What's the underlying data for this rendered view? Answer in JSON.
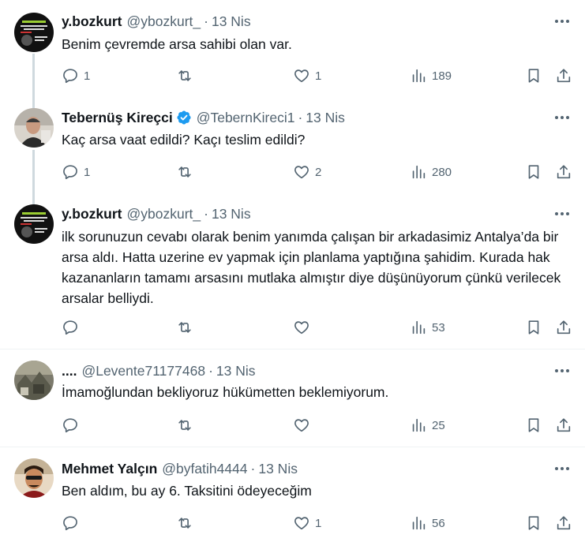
{
  "tweets": [
    {
      "name": "y.bozkurt",
      "handle": "@ybozkurt_",
      "dot": "·",
      "time": "13 Nis",
      "verified": false,
      "text": "Benim çevremde arsa sahibi olan var.",
      "replies": "1",
      "retweets": "",
      "likes": "1",
      "views": "189"
    },
    {
      "name": "Tebernüş Kireçci",
      "handle": "@TebernKireci1",
      "dot": "·",
      "time": "13 Nis",
      "verified": true,
      "text": "Kaç arsa vaat edildi? Kaçı teslim edildi?",
      "replies": "1",
      "retweets": "",
      "likes": "2",
      "views": "280"
    },
    {
      "name": "y.bozkurt",
      "handle": "@ybozkurt_",
      "dot": "·",
      "time": "13 Nis",
      "verified": false,
      "text": "ilk sorunuzun cevabı olarak benim yanımda çalışan bir arkadasimiz Antalya’da bir arsa aldı. Hatta uzerine ev yapmak için planlama yaptığına şahidim. Kurada hak kazananların tamamı arsasını mutlaka almıştır diye düşünüyorum çünkü verilecek arsalar belliydi.",
      "replies": "",
      "retweets": "",
      "likes": "",
      "views": "53"
    },
    {
      "name": "....",
      "handle": "@Levente71177468",
      "dot": "·",
      "time": "13 Nis",
      "verified": false,
      "text": "İmamoğlundan bekliyoruz hükümetten beklemiyorum.",
      "replies": "",
      "retweets": "",
      "likes": "",
      "views": "25"
    },
    {
      "name": "Mehmet Yalçın",
      "handle": "@byfatih4444",
      "dot": "·",
      "time": "13 Nis",
      "verified": false,
      "text": "Ben aldım, bu ay 6. Taksitini ödeyeceğim",
      "replies": "",
      "retweets": "",
      "likes": "1",
      "views": "56"
    }
  ],
  "icons": {
    "reply": "reply-icon",
    "retweet": "retweet-icon",
    "like": "heart-icon",
    "views": "views-icon",
    "bookmark": "bookmark-icon",
    "share": "share-icon",
    "more": "more-icon"
  },
  "colors": {
    "text": "#0f1419",
    "secondary": "#536471",
    "verified": "#1d9bf0",
    "thread_line": "#cfd9de",
    "divider": "#eff3f4"
  }
}
